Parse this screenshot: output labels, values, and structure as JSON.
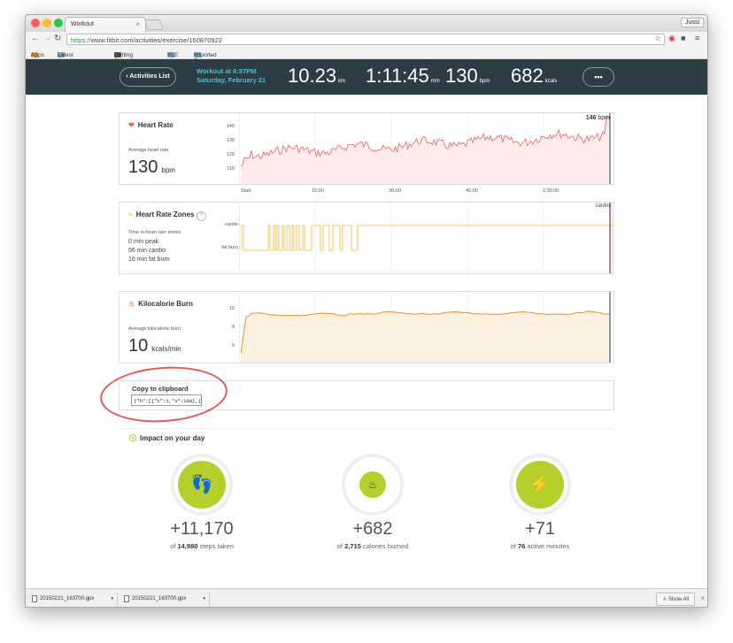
{
  "browser": {
    "tab_title": "Workout",
    "user_label": "Jussi",
    "url_scheme": "https://",
    "url_rest": "www.fitbit.com/activities/exercise/160870922",
    "bookmarks": [
      "Apps",
      "Latest Headlines",
      "Getting Started",
      "YLE",
      "Imported From Fire..."
    ]
  },
  "header": {
    "back_label": "‹ Activities List",
    "workout_title": "Workout at 6:37PM",
    "workout_date": "Saturday, February 21",
    "stats": [
      {
        "value": "10.23",
        "unit": "km"
      },
      {
        "value": "1:11:45",
        "unit": "mm"
      },
      {
        "value": "130",
        "unit": "bpm"
      },
      {
        "value": "682",
        "unit": "kcals"
      }
    ],
    "more_label": "•••"
  },
  "heart_rate": {
    "title": "Heart Rate",
    "sub": "Average heart rate",
    "value": "130",
    "unit": "bpm",
    "peak_label": "146",
    "peak_unit": "bpm",
    "y_ticks": [
      "140",
      "130",
      "120",
      "110"
    ],
    "x_ticks": [
      "Start",
      "15:00",
      "30:00",
      "45:00",
      "1:00:00"
    ]
  },
  "zones": {
    "title": "Heart Rate Zones",
    "help": "?",
    "sub": "Time in heart rate zones",
    "peak": "0 min peak",
    "cardio": "56 min cardio",
    "fatburn": "16 min fat burn",
    "y_top": "cardio",
    "y_bottom": "fat burn",
    "corner": "cardio"
  },
  "kcal": {
    "title": "Kilocalorie Burn",
    "sub": "Average kilocalorie burn",
    "value": "10",
    "unit": "kcals/min",
    "y_ticks": [
      "10",
      "8",
      "6"
    ]
  },
  "clipboard": {
    "label": "Copy to clipboard",
    "value": "{\"h\":[{\"t\":1,\"v\":108},{\"t\":6,\"v\":11"
  },
  "impact": {
    "title": "Impact on your day",
    "items": [
      {
        "value": "+11,170",
        "pre": "of",
        "bold": "14,980",
        "post": "steps taken"
      },
      {
        "value": "+682",
        "pre": "of",
        "bold": "2,715",
        "post": "calories burned"
      },
      {
        "value": "+71",
        "pre": "of",
        "bold": "76",
        "post": "active minutes"
      }
    ]
  },
  "downloads": {
    "files": [
      "20150221_163700.gpx",
      "20150221_163700.gpx"
    ],
    "show_all": "Show All"
  },
  "colors": {
    "hr_line": "#e8625c",
    "hr_fill": "#fdeceb",
    "zone_line": "#f2b93b",
    "kcal_line": "#f08f1e",
    "kcal_fill": "#fdf0e0",
    "accent_green": "#b6cf2c"
  }
}
